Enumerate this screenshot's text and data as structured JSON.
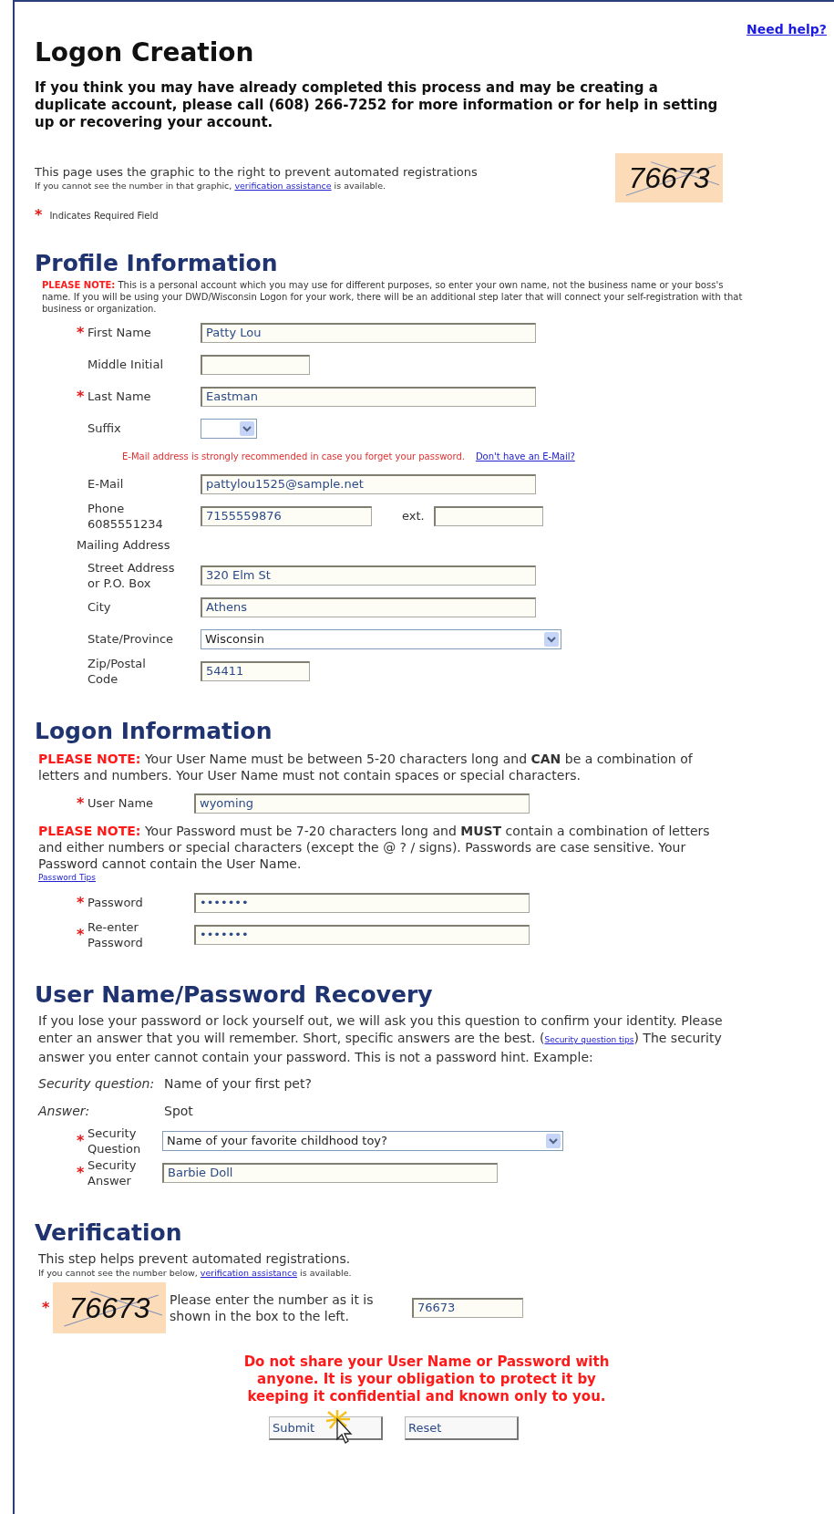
{
  "help_link": "Need help?",
  "title": "Logon Creation",
  "intro": "If you think you may have already completed this process and may be creating a duplicate account, please call (608) 266-7252 for more information or for help in setting up or recovering your account.",
  "captcha_notice": {
    "text": "This page uses the graphic to the right to prevent automated registrations",
    "assist_before": "If you cannot see the number in that graphic,",
    "assist_link": "verification assistance",
    "assist_after": "is available.",
    "code": "76673"
  },
  "required_legend": {
    "mark": "*",
    "text": "Indicates Required Field"
  },
  "sections": [
    {
      "kind": "profile",
      "heading": "Profile Information",
      "note": {
        "label": "PLEASE NOTE:",
        "text": "This is a personal account which you may use for different purposes, so enter your own name, not the business name or your boss's name. If you will be using your DWD/Wisconsin Logon for your work, there will be an additional step later that will connect your self-registration with that business or organization."
      },
      "rows": [
        {
          "kind": "text",
          "label": [
            "First Name"
          ],
          "required": true,
          "value": "Patty Lou"
        },
        {
          "kind": "short_text",
          "label": [
            "Middle Initial"
          ],
          "required": false
        },
        {
          "kind": "text",
          "label": [
            "Last Name"
          ],
          "required": true,
          "value": "Eastman"
        },
        {
          "kind": "short_select",
          "label": [
            "Suffix"
          ],
          "required": false
        },
        {
          "kind": "note",
          "text": "E-Mail address is strongly recommended in case you forget your password.",
          "link": "Don't have an E-Mail?"
        },
        {
          "kind": "text",
          "label": [
            "E-Mail"
          ],
          "required": false,
          "value": "pattylou1525@sample.net"
        },
        {
          "kind": "phone",
          "label": [
            "Phone",
            "6085551234"
          ],
          "required": false,
          "value": "7155559876",
          "ext_label": "ext."
        },
        {
          "kind": "heading",
          "text": "Mailing Address"
        },
        {
          "kind": "text",
          "label": [
            "Street Address",
            "or P.O. Box"
          ],
          "required": false,
          "value": "320 Elm St"
        },
        {
          "kind": "text",
          "label": [
            "City"
          ],
          "required": false,
          "value": "Athens"
        },
        {
          "kind": "select",
          "label": [
            "State/Province"
          ],
          "required": false,
          "value": "Wisconsin"
        },
        {
          "kind": "short_text",
          "label": [
            "Zip/Postal",
            "Code"
          ],
          "required": false,
          "value": "54411"
        }
      ]
    },
    {
      "kind": "logon",
      "heading": "Logon Information",
      "rows": [
        {
          "kind": "para",
          "label": "PLEASE NOTE:",
          "text": "Your User Name must be between 5-20 characters long and **CAN** be a combination of letters and numbers. Your User Name must not contain spaces or special characters."
        },
        {
          "kind": "text",
          "label": [
            "User Name"
          ],
          "required": true,
          "value": "wyoming"
        },
        {
          "kind": "para",
          "label": "PLEASE NOTE:",
          "text": "Your Password must be 7-20 characters long and **MUST** contain a combination of letters and either numbers or special characters (except the @ ? / signs). Passwords are case sensitive. Your Password cannot contain the User Name.",
          "link": "Password Tips"
        },
        {
          "kind": "password",
          "label": [
            "Password"
          ],
          "required": true,
          "value": "•••••••"
        },
        {
          "kind": "password",
          "label": [
            "Re-enter",
            "Password"
          ],
          "required": true,
          "value": "•••••••"
        }
      ]
    },
    {
      "kind": "recovery",
      "heading": "User Name/Password Recovery",
      "rows": [
        {
          "kind": "para",
          "text_before": "If you lose your password or lock yourself out, we will ask you this question to confirm your identity. Please enter an answer that you will remember. Short, specific answers are the best. (",
          "link": "Security question tips",
          "text_after": ") The security answer you enter cannot contain your password. This is not a password hint. Example:"
        },
        {
          "kind": "example",
          "label": "Security question:",
          "value": "Name of your first pet?"
        },
        {
          "kind": "example",
          "label": "Answer:",
          "value": "Spot"
        },
        {
          "kind": "select",
          "label": [
            "Security",
            "Question"
          ],
          "required": true,
          "value": "Name of your favorite childhood toy?"
        },
        {
          "kind": "text",
          "label": [
            "Security",
            "Answer"
          ],
          "required": true,
          "value": "Barbie Doll"
        }
      ]
    }
  ],
  "verification": {
    "heading": "Verification",
    "text": "This step helps prevent automated registrations.",
    "assist_before": "If you cannot see the number below,",
    "assist_link": "verification assistance",
    "assist_after": "is available.",
    "required": true,
    "code": "76673",
    "prompt": "Please enter the number as it is shown in the box to the left.",
    "value": "76673"
  },
  "warning": "Do not share your User Name or Password with anyone.  It is your obligation to protect it by keeping it confidential and known only to you.",
  "buttons": [
    "Submit",
    "Reset"
  ]
}
